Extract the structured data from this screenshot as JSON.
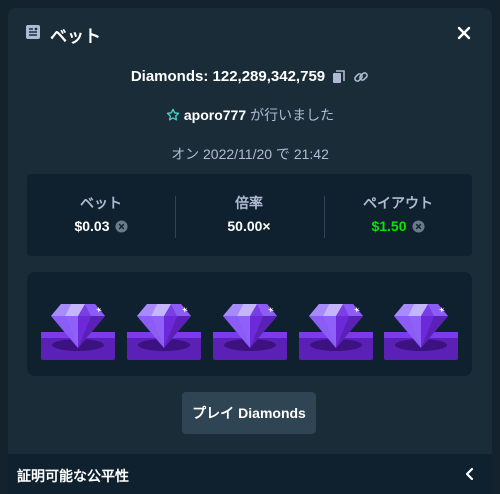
{
  "modal": {
    "title": "ベット",
    "diamonds_label": "Diamonds: 122,289,342,759",
    "player_name": "aporo777",
    "player_suffix": "が行いました",
    "date_text": "オン 2022/11/20 で 21:42"
  },
  "stats": [
    {
      "label": "ベット",
      "value": "$0.03"
    },
    {
      "label": "倍率",
      "value": "50.00×"
    },
    {
      "label": "ペイアウト",
      "value": "$1.50"
    }
  ],
  "gems": {
    "count": 5,
    "color": "#7a3fe4"
  },
  "play_button": {
    "prefix": "プレイ",
    "game": "Diamonds"
  },
  "footer": {
    "label": "証明可能な公平性"
  },
  "colors": {
    "panel": "#1a2c38",
    "inner_panel": "#0f212e",
    "accent_green": "#00e701",
    "muted": "#b1bad3"
  },
  "icons": [
    "bet-slip-icon",
    "close-icon",
    "copy-icon",
    "link-icon",
    "star-badge-icon",
    "coin-icon",
    "chevron-left-icon",
    "diamond-gem-icon"
  ]
}
